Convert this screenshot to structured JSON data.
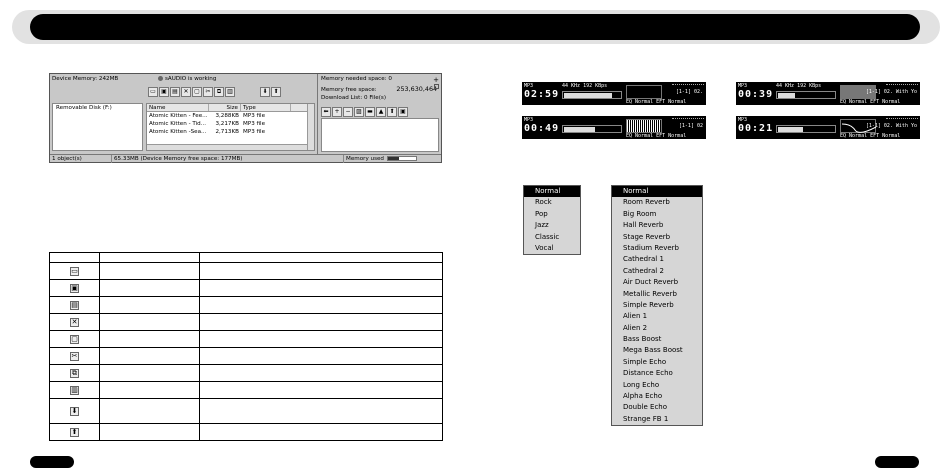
{
  "app": {
    "device_memory": "Device Memory: 242MB",
    "status": "sAUDIO is working",
    "tree_item": "Removable Disk (F:)",
    "columns": [
      "Name",
      "Size",
      "Type"
    ],
    "files": [
      {
        "name": "Atomic Kitten - Fee...",
        "size": "3,288KB",
        "type": "MP3 file"
      },
      {
        "name": "Atomic Kitten - Tid...",
        "size": "3,217KB",
        "type": "MP3 file"
      },
      {
        "name": "Atomic Kitten -Sea...",
        "size": "2,713KB",
        "type": "MP3 file"
      }
    ],
    "memory_needed": "Memory needed space: 0",
    "memory_free_label": "Memory free space:",
    "memory_free_value": "253,630,464",
    "download_list": "Download List: 0 File(s)",
    "status_objects": "1 object(s)",
    "status_device": "65.33MB (Device Memory free space: 177MB)",
    "status_memory_used": "Memory used",
    "memory_used_fraction": 0.4
  },
  "icon_table_rows": 10,
  "players": [
    {
      "mp3": "MP3",
      "time": "02:59",
      "rate": "44 KHz 192 KBps",
      "track": "[1-1] 02.",
      "eq": "EQ Normal",
      "eft": "EFT Normal",
      "level": 0.85
    },
    {
      "mp3": "MP3",
      "time": "00:39",
      "rate": "44 KHz 192 KBps",
      "track": "[1-1] 02. With Yo",
      "eq": "EQ Normal",
      "eft": "EFT Normal",
      "level": 0.3
    },
    {
      "mp3": "MP3",
      "time": "00:49",
      "rate": "",
      "track": "[1-1] 02",
      "eq": "EQ Normal",
      "eft": "EFT Normal",
      "level": 0.55
    },
    {
      "mp3": "MP3",
      "time": "00:21",
      "rate": "",
      "track": "[1-1] 02. With Yo",
      "eq": "EQ Normal",
      "eft": "EFT Normal",
      "level": 0.45
    }
  ],
  "eq_menu": {
    "selected": "Normal",
    "items": [
      "Normal",
      "Rock",
      "Pop",
      "Jazz",
      "Classic",
      "Vocal"
    ]
  },
  "effect_menu": {
    "selected": "Normal",
    "items": [
      "Normal",
      "Room Reverb",
      "Big Room",
      "Hall Reverb",
      "Stage Reverb",
      "Stadium Reverb",
      "Cathedral 1",
      "Cathedral 2",
      "Air Duct Reverb",
      "Metallic Reverb",
      "Simple Reverb",
      "Alien 1",
      "Alien 2",
      "Bass Boost",
      "Mega Bass Boost",
      "Simple Echo",
      "Distance Echo",
      "Long Echo",
      "Alpha Echo",
      "Double Echo",
      "Strange FB 1"
    ]
  },
  "colors": {
    "header": "#000000",
    "menu_bg": "#d6d6d6",
    "selected": "#000000"
  }
}
